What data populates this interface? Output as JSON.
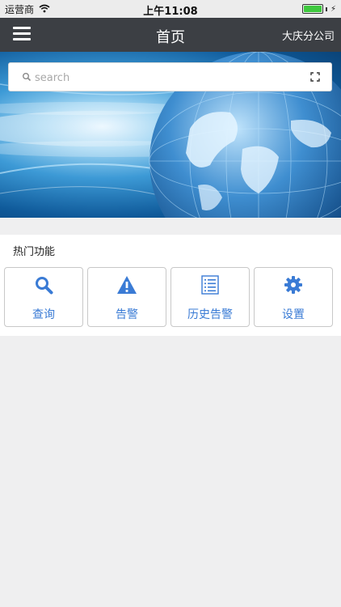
{
  "status_bar": {
    "carrier": "运营商",
    "time": "上午11:08",
    "battery_level": 1.0
  },
  "nav": {
    "title": "首页",
    "company": "大庆分公司"
  },
  "search": {
    "placeholder": "search",
    "value": ""
  },
  "hot_functions": {
    "title": "热门功能",
    "items": [
      {
        "label": "查询",
        "icon": "search-icon"
      },
      {
        "label": "告警",
        "icon": "warning-icon"
      },
      {
        "label": "历史告警",
        "icon": "list-icon"
      },
      {
        "label": "设置",
        "icon": "gear-icon"
      }
    ]
  },
  "colors": {
    "accent": "#3a7bd5",
    "nav_bg": "#3c3f44",
    "page_bg": "#efeff0"
  }
}
